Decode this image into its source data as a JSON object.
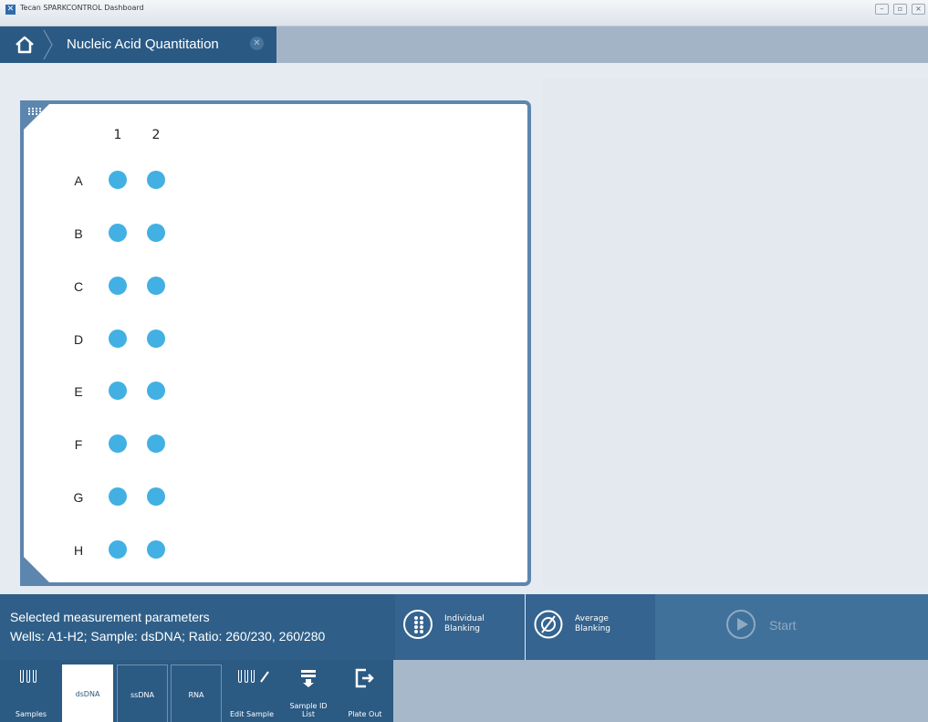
{
  "window": {
    "title": "Tecan SPARKCONTROL Dashboard",
    "icon": "tecan-x-icon",
    "controls": [
      "minimize",
      "restore",
      "close"
    ]
  },
  "nav": {
    "home_icon": "home-icon",
    "title": "Nucleic Acid Quantitation",
    "close_icon": "close-circle-icon"
  },
  "plate": {
    "layout_icon": "plate-grid-icon",
    "columns": [
      "1",
      "2"
    ],
    "rows": [
      "A",
      "B",
      "C",
      "D",
      "E",
      "F",
      "G",
      "H"
    ],
    "well_color": "#42b0e3"
  },
  "params": {
    "title": "Selected measurement parameters",
    "text": "Wells: A1-H2; Sample: dsDNA; Ratio: 260/230, 260/280"
  },
  "blanking": {
    "individual": {
      "line1": "Individual",
      "line2": "Blanking",
      "icon": "individual-blanking-icon"
    },
    "average": {
      "line1": "Average",
      "line2": "Blanking",
      "icon": "average-blanking-icon"
    }
  },
  "start": {
    "label": "Start",
    "icon": "play-icon"
  },
  "toolbar": {
    "samples": "Samples",
    "dsdna": "dsDNA",
    "ssdna": "ssDNA",
    "rna": "RNA",
    "edit_sample": "Edit Sample",
    "sample_id_line1": "Sample ID",
    "sample_id_line2": "List",
    "plate_out": "Plate Out",
    "active_tab": "dsDNA"
  },
  "colors": {
    "nav_dark": "#2a5a84",
    "panel_border": "#5d86ae",
    "well": "#42b0e3",
    "background": "#e6eaf1"
  }
}
